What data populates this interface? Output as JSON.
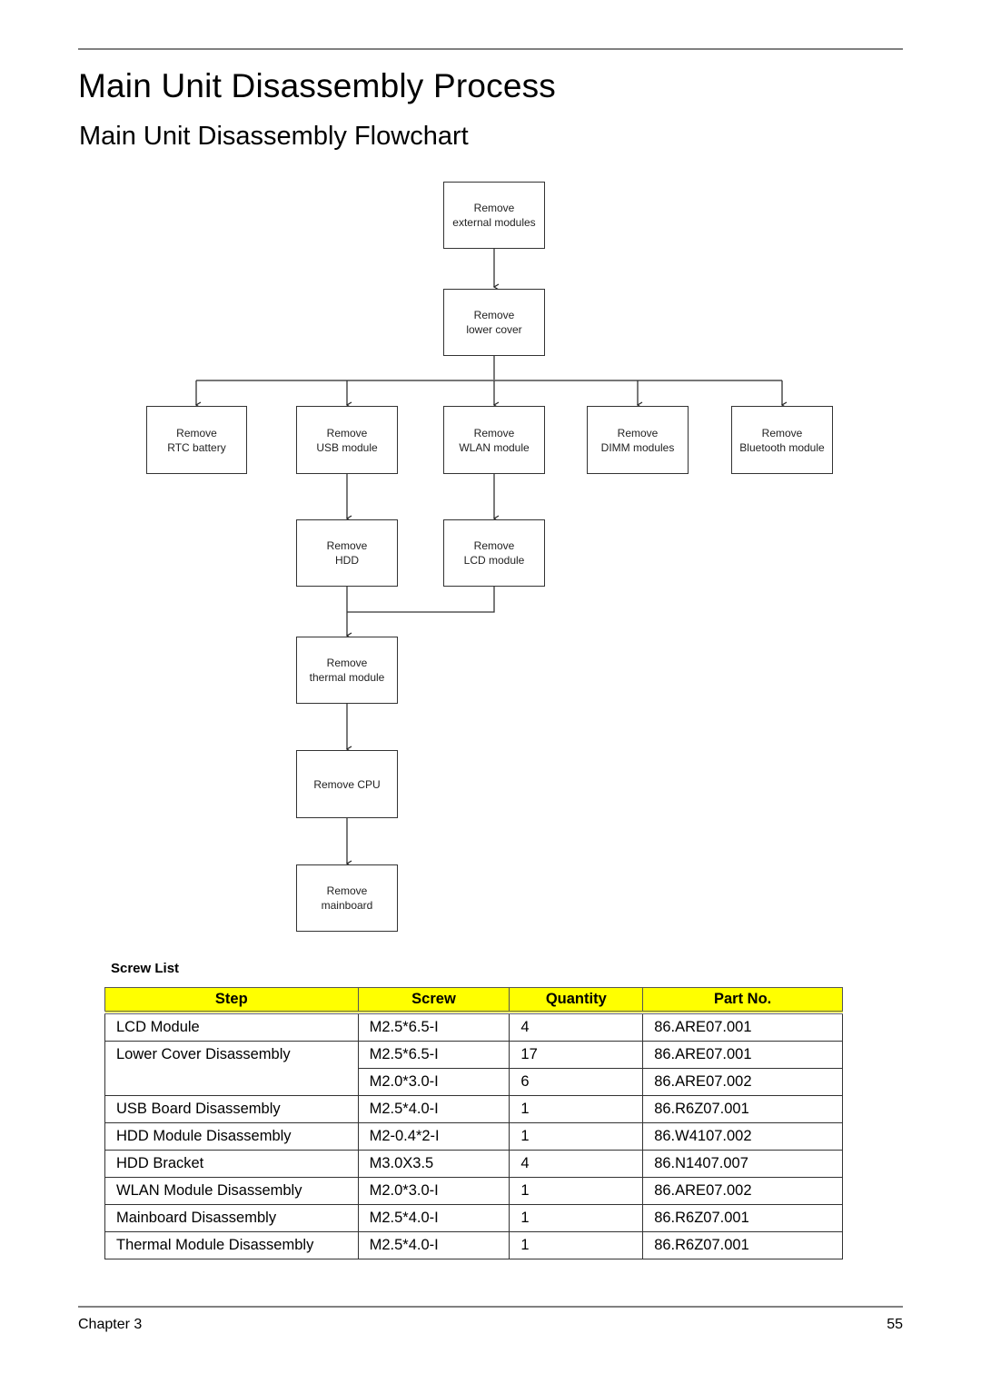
{
  "page": {
    "title": "Main Unit Disassembly Process",
    "subtitle": "Main Unit Disassembly Flowchart"
  },
  "flowchart": {
    "nodes": {
      "external": [
        "Remove",
        "external modules"
      ],
      "lower_cover": [
        "Remove",
        "lower cover"
      ],
      "rtc": [
        "Remove",
        "RTC battery"
      ],
      "usb": [
        "Remove",
        "USB module"
      ],
      "wlan": [
        "Remove",
        "WLAN module"
      ],
      "dimm": [
        "Remove",
        "DIMM modules"
      ],
      "bluetooth": [
        "Remove",
        "Bluetooth module"
      ],
      "hdd": [
        "Remove",
        "HDD"
      ],
      "lcd": [
        "Remove",
        "LCD module"
      ],
      "thermal": [
        "Remove",
        "thermal module"
      ],
      "cpu": [
        "Remove CPU"
      ],
      "mainboard": [
        "Remove",
        "mainboard"
      ]
    },
    "edges": [
      [
        "external",
        "lower_cover"
      ],
      [
        "lower_cover",
        "rtc"
      ],
      [
        "lower_cover",
        "usb"
      ],
      [
        "lower_cover",
        "wlan"
      ],
      [
        "lower_cover",
        "dimm"
      ],
      [
        "lower_cover",
        "bluetooth"
      ],
      [
        "usb",
        "hdd"
      ],
      [
        "wlan",
        "lcd"
      ],
      [
        "hdd",
        "thermal"
      ],
      [
        "lcd",
        "thermal"
      ],
      [
        "thermal",
        "cpu"
      ],
      [
        "cpu",
        "mainboard"
      ]
    ]
  },
  "screw_list": {
    "title": "Screw List",
    "header_color": "#ffff00",
    "columns": [
      "Step",
      "Screw",
      "Quantity",
      "Part No."
    ],
    "rows": [
      {
        "step": "LCD Module",
        "screw": "M2.5*6.5-I",
        "quantity": "4",
        "part_no": "86.ARE07.001"
      },
      {
        "step": "Lower Cover Disassembly",
        "screw": "M2.5*6.5-I",
        "quantity": "17",
        "part_no": "86.ARE07.001"
      },
      {
        "step": "",
        "screw": "M2.0*3.0-I",
        "quantity": "6",
        "part_no": "86.ARE07.002"
      },
      {
        "step": "USB Board Disassembly",
        "screw": "M2.5*4.0-I",
        "quantity": "1",
        "part_no": "86.R6Z07.001"
      },
      {
        "step": "HDD Module Disassembly",
        "screw": "M2-0.4*2-I",
        "quantity": "1",
        "part_no": "86.W4107.002"
      },
      {
        "step": "HDD Bracket",
        "screw": "M3.0X3.5",
        "quantity": "4",
        "part_no": "86.N1407.007"
      },
      {
        "step": "WLAN Module Disassembly",
        "screw": "M2.0*3.0-I",
        "quantity": "1",
        "part_no": "86.ARE07.002"
      },
      {
        "step": "Mainboard Disassembly",
        "screw": "M2.5*4.0-I",
        "quantity": "1",
        "part_no": "86.R6Z07.001"
      },
      {
        "step": "Thermal Module Disassembly",
        "screw": "M2.5*4.0-I",
        "quantity": "1",
        "part_no": "86.R6Z07.001"
      }
    ]
  },
  "footer": {
    "chapter": "Chapter 3",
    "page_number": "55"
  }
}
